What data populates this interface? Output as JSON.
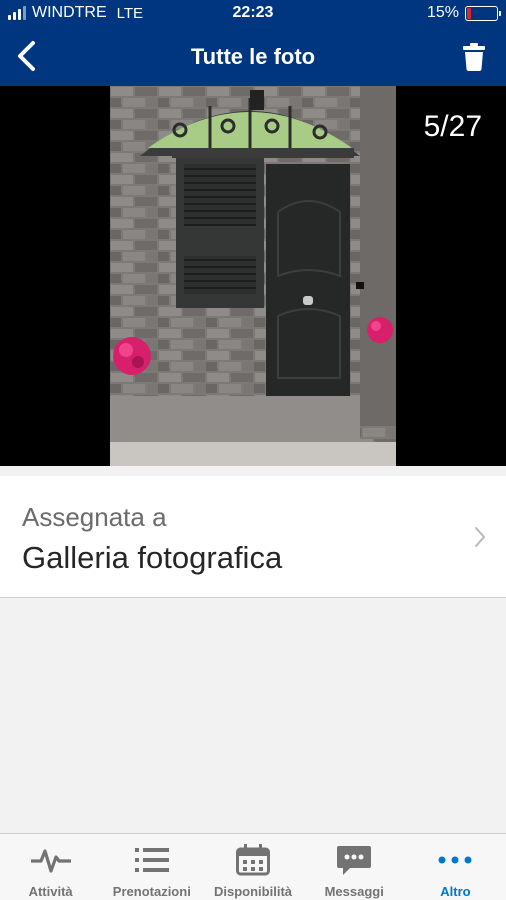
{
  "status_bar": {
    "carrier": "WINDTRE",
    "network": "LTE",
    "time": "22:23",
    "battery_percent": "15%",
    "battery_level": 0.15,
    "battery_color": "#e0262b"
  },
  "nav": {
    "title": "Tutte le foto",
    "back_icon": "chevron-left-icon",
    "trash_icon": "trash-icon",
    "background": "#003580"
  },
  "photo_viewer": {
    "counter": "5/27"
  },
  "assignment": {
    "label": "Assegnata a",
    "value": "Galleria fotografica"
  },
  "tab_bar": {
    "active_color": "#0077cc",
    "tabs": [
      {
        "label": "Attività",
        "icon": "activity-icon",
        "active": false
      },
      {
        "label": "Prenotazioni",
        "icon": "list-icon",
        "active": false
      },
      {
        "label": "Disponibilità",
        "icon": "calendar-icon",
        "active": false
      },
      {
        "label": "Messaggi",
        "icon": "message-icon",
        "active": false
      },
      {
        "label": "Altro",
        "icon": "more-icon",
        "active": true
      }
    ]
  }
}
